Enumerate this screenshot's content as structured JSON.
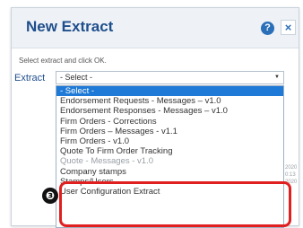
{
  "dialog": {
    "title": "New Extract",
    "help_glyph": "?",
    "close_glyph": "×",
    "instruction": "Select extract and click OK.",
    "extract_label": "Extract",
    "select_value": "- Select -"
  },
  "dropdown": {
    "options": [
      "- Select -",
      "Endorsement Requests - Messages – v1.0",
      "Endorsement Responses - Messages – v1.0",
      "Firm Orders - Corrections",
      "Firm Orders – Messages - v1.1",
      "Firm Orders - v1.0",
      "Quote To Firm Order Tracking",
      "Quote - Messages - v1.0",
      "Company stamps",
      "Stamps/Users",
      "User Configuration Extract"
    ]
  },
  "background": {
    "side_texts": [
      "2020",
      "0:13",
      "2020"
    ]
  },
  "annotation": {
    "step_number": "❸"
  },
  "colors": {
    "selected_option_bg": "#1e7ad6",
    "highlight_border": "#e02020",
    "title_color": "#1f4e8c"
  },
  "icons": [
    "help-icon",
    "close-icon",
    "chevron-down-icon"
  ]
}
